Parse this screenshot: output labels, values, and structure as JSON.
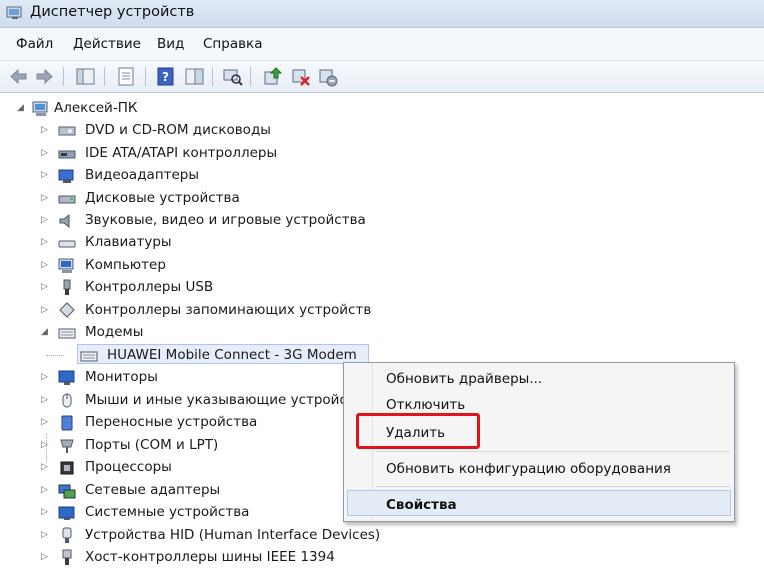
{
  "window": {
    "title": "Диспетчер устройств"
  },
  "menu": [
    "Файл",
    "Действие",
    "Вид",
    "Справка"
  ],
  "toolbar": {
    "buttons": [
      "back-arrow-icon",
      "forward-arrow-icon",
      "show-hide-tree-icon",
      "properties-icon",
      "help-icon",
      "view-icon",
      "scan-hardware-icon",
      "update-driver-icon",
      "disable-device-icon",
      "uninstall-device-icon"
    ]
  },
  "tree": {
    "root": "Алексей-ПК",
    "categories": [
      {
        "label": "DVD и CD-ROM дисководы",
        "icon": "dvd-drive-icon"
      },
      {
        "label": "IDE ATA/ATAPI контроллеры",
        "icon": "ide-controller-icon"
      },
      {
        "label": "Видеоадаптеры",
        "icon": "display-adapter-icon"
      },
      {
        "label": "Дисковые устройства",
        "icon": "disk-drive-icon"
      },
      {
        "label": "Звуковые, видео и игровые устройства",
        "icon": "speaker-icon"
      },
      {
        "label": "Клавиатуры",
        "icon": "keyboard-icon"
      },
      {
        "label": "Компьютер",
        "icon": "computer-icon"
      },
      {
        "label": "Контроллеры USB",
        "icon": "usb-icon"
      },
      {
        "label": "Контроллеры запоминающих устройств",
        "icon": "storage-controller-icon"
      },
      {
        "label": "Модемы",
        "icon": "modem-icon"
      },
      {
        "label": "HUAWEI Mobile Connect - 3G Modem",
        "icon": "modem-device-icon"
      },
      {
        "label": "Мониторы",
        "icon": "monitor-icon"
      },
      {
        "label": "Мыши и иные указывающие устройства",
        "icon": "mouse-icon"
      },
      {
        "label": "Переносные устройства",
        "icon": "portable-device-icon"
      },
      {
        "label": "Порты (COM и LPT)",
        "icon": "port-icon"
      },
      {
        "label": "Процессоры",
        "icon": "processor-icon"
      },
      {
        "label": "Сетевые адаптеры",
        "icon": "network-adapter-icon"
      },
      {
        "label": "Системные устройства",
        "icon": "system-device-icon"
      },
      {
        "label": "Устройства HID (Human Interface Devices)",
        "icon": "hid-icon"
      },
      {
        "label": "Хост-контроллеры шины IEEE 1394",
        "icon": "ieee1394-icon"
      }
    ]
  },
  "context_menu": {
    "update_drivers": "Обновить драйверы...",
    "disable": "Отключить",
    "uninstall": "Удалить",
    "scan_hardware": "Обновить конфигурацию оборудования",
    "properties": "Свойства"
  }
}
